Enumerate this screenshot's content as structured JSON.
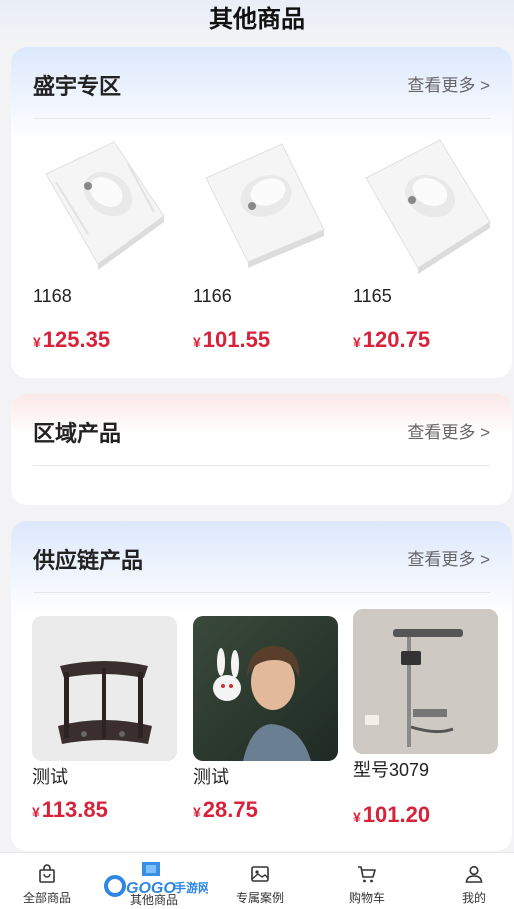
{
  "header": {
    "title": "其他商品"
  },
  "sections": [
    {
      "title": "盛宇专区",
      "more": "查看更多 >",
      "products": [
        {
          "name": "1168",
          "currency": "¥",
          "price": "125.35"
        },
        {
          "name": "1166",
          "currency": "¥",
          "price": "101.55"
        },
        {
          "name": "1165",
          "currency": "¥",
          "price": "120.75"
        }
      ]
    },
    {
      "title": "区域产品",
      "more": "查看更多 >",
      "products": []
    },
    {
      "title": "供应链产品",
      "more": "查看更多 >",
      "products": [
        {
          "name": "测试",
          "currency": "¥",
          "price": "113.85"
        },
        {
          "name": "测试",
          "currency": "¥",
          "price": "28.75"
        },
        {
          "name": "型号3079",
          "currency": "¥",
          "price": "101.20"
        }
      ]
    }
  ],
  "tabbar": {
    "items": [
      {
        "label": "全部商品",
        "icon": "bag-icon"
      },
      {
        "label": "其他商品",
        "icon": "logo-icon"
      },
      {
        "label": "专属案例",
        "icon": "image-icon"
      },
      {
        "label": "购物车",
        "icon": "cart-icon"
      },
      {
        "label": "我的",
        "icon": "user-icon"
      }
    ]
  },
  "logo": {
    "text": "GOGO手游网"
  },
  "colors": {
    "price": "#d8223a",
    "accent_blue": "#dce8fb",
    "accent_pink": "#fbe8e8"
  }
}
